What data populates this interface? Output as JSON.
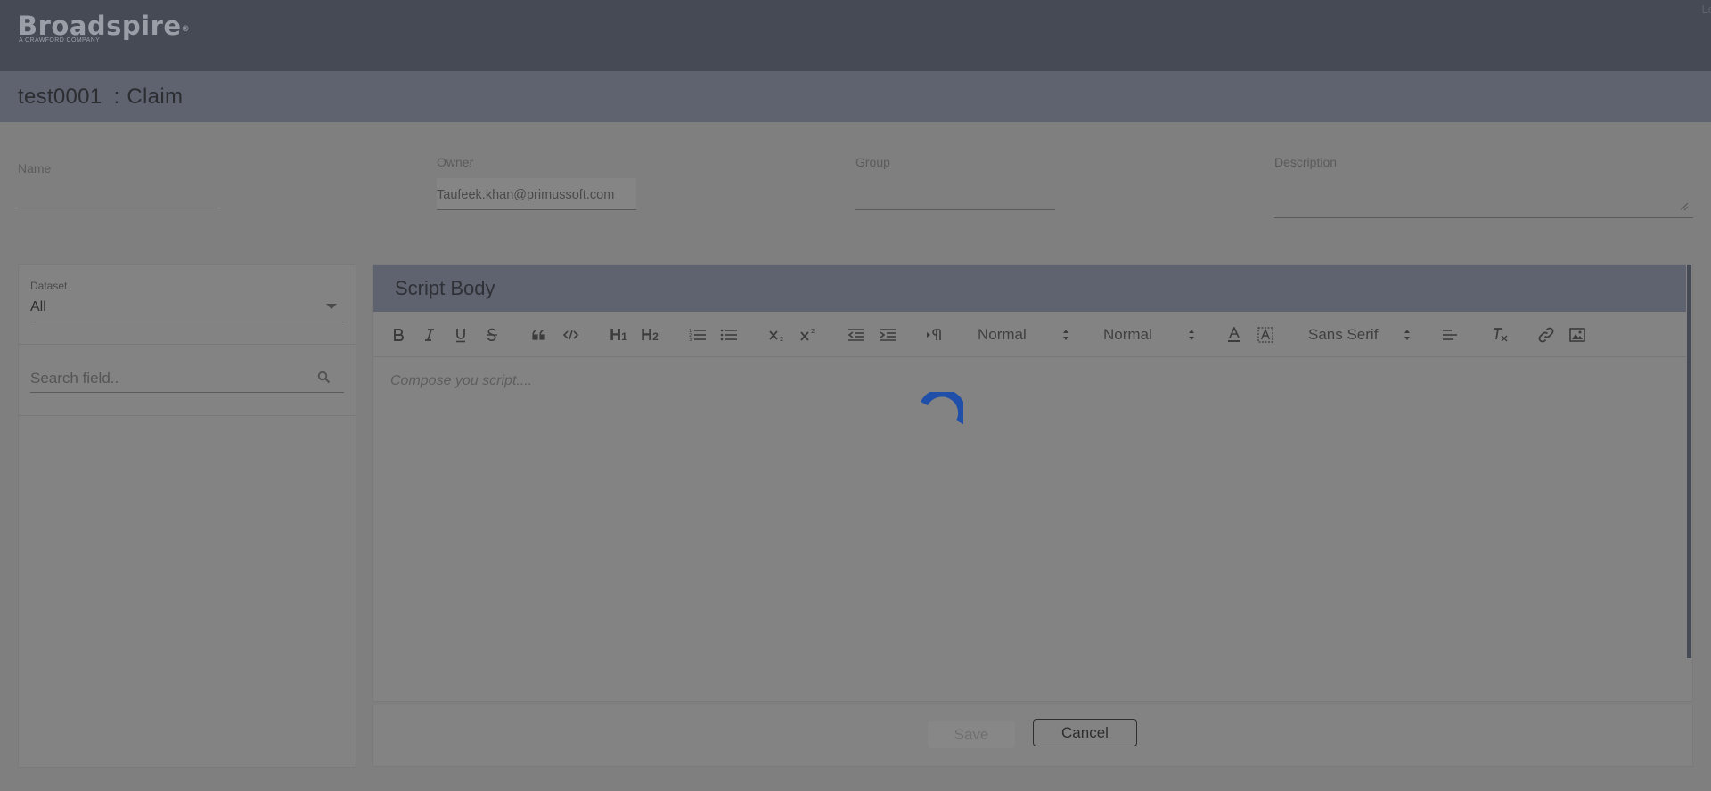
{
  "header": {
    "logo_text": "Broadspire",
    "logo_mark": "®",
    "logo_sub": "A CRAWFORD COMPANY",
    "logout_label": "Lo"
  },
  "page": {
    "title_id": "test0001",
    "title_sep": ":",
    "title_type": "Claim"
  },
  "form": {
    "name_label": "Name",
    "name_value": "",
    "owner_label": "Owner",
    "owner_value": "Taufeek.khan@primussoft.com",
    "group_label": "Group",
    "group_value": "",
    "description_label": "Description",
    "description_value": ""
  },
  "left_panel": {
    "dataset_label": "Dataset",
    "dataset_value": "All",
    "search_placeholder": "Search field.."
  },
  "editor": {
    "title": "Script Body",
    "toolbar": {
      "h1": "H",
      "h1_sub": "1",
      "h2": "H",
      "h2_sub": "2",
      "size_value": "Normal",
      "header_value": "Normal",
      "font_value": "Sans Serif"
    },
    "placeholder": "Compose you script....",
    "loading": true
  },
  "footer": {
    "save_label": "Save",
    "cancel_label": "Cancel"
  },
  "colors": {
    "header_bg": "#454a55",
    "title_band_bg": "#5f6370",
    "overlay_bg": "#7f7f7f",
    "spinner": "#1f4fa8"
  },
  "icons": [
    "bold-icon",
    "italic-icon",
    "underline-icon",
    "strikethrough-icon",
    "blockquote-icon",
    "code-icon",
    "ordered-list-icon",
    "bullet-list-icon",
    "subscript-icon",
    "superscript-icon",
    "outdent-icon",
    "indent-icon",
    "text-direction-icon",
    "font-color-icon",
    "background-color-icon",
    "align-icon",
    "clean-format-icon",
    "link-icon",
    "image-icon",
    "search-icon",
    "chevron-down-icon",
    "loading-spinner-icon"
  ]
}
